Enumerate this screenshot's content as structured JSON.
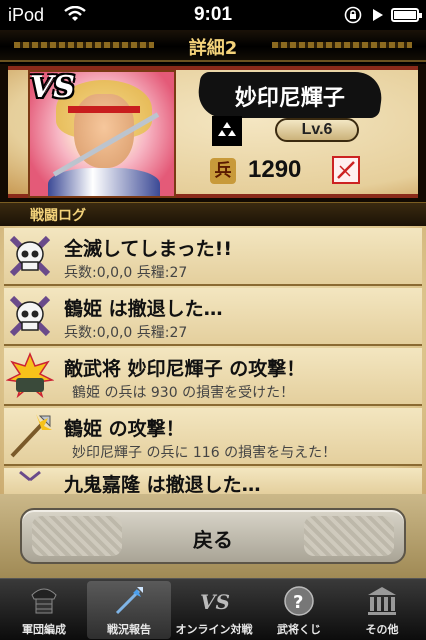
{
  "status_bar": {
    "carrier": "iPod",
    "time": "9:01"
  },
  "header": {
    "title": "詳細2"
  },
  "profile": {
    "vs_badge": "VS",
    "name": "妙印尼輝子",
    "level": "Lv.6",
    "troops_icon_char": "兵",
    "troops": "1290",
    "icons": [
      "crest-icon",
      "weapon-icon"
    ]
  },
  "log": {
    "header": "戦闘ログ",
    "items": [
      {
        "icon": "skull-icon",
        "title": "全滅してしまった!!",
        "detail": "兵数:0,0,0 兵糧:27"
      },
      {
        "icon": "skull-icon",
        "title": "鶴姫 は撤退した…",
        "detail": "兵数:0,0,0 兵糧:27"
      },
      {
        "icon": "explosion-icon",
        "title": "敵武将 妙印尼輝子 の攻撃！",
        "detail": "鶴姫 の兵は 930 の損害を受けた！"
      },
      {
        "icon": "spear-attack-icon",
        "title": "鶴姫 の攻撃！",
        "detail": "妙印尼輝子 の兵に 116 の損害を与えた！"
      },
      {
        "icon": "retreat-icon",
        "title": "九鬼嘉隆 は撤退した…",
        "detail": ""
      }
    ]
  },
  "back_button": {
    "label": "戻る"
  },
  "tabs": [
    {
      "label": "軍団編成",
      "icon": "armor-icon",
      "active": false
    },
    {
      "label": "戦況報告",
      "icon": "battle-report-icon",
      "active": true
    },
    {
      "label": "オンライン対戦",
      "icon": "versus-icon",
      "active": false
    },
    {
      "label": "武将くじ",
      "icon": "question-icon",
      "active": false
    },
    {
      "label": "その他",
      "icon": "building-icon",
      "active": false
    }
  ],
  "colors": {
    "title_gold": "#f3d27a",
    "paper": "#e6cf9b",
    "tab_bar": "#1c1c1c"
  }
}
